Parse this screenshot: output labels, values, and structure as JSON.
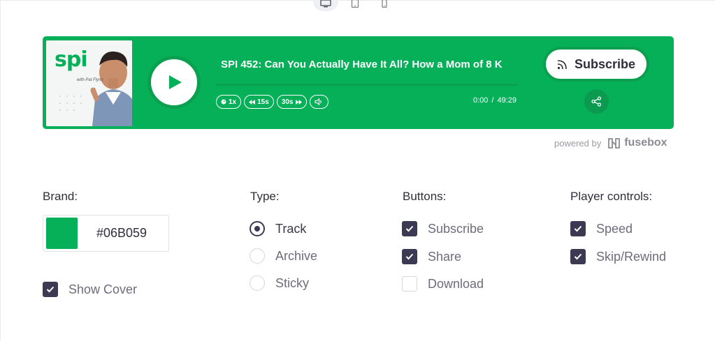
{
  "colors": {
    "brand": "#06B059",
    "dark": "#3b3a52"
  },
  "device_tabs": [
    {
      "icon": "desktop-icon",
      "active": true
    },
    {
      "icon": "tablet-icon",
      "active": false
    },
    {
      "icon": "mobile-icon",
      "active": false
    }
  ],
  "player": {
    "cover": {
      "logo": "spi",
      "byline": "with Pat Flynn"
    },
    "title": "SPI 452: Can You Actually Have It All? How a Mom of 8 K",
    "controls": {
      "speed": "1x",
      "rewind": "15s",
      "forward": "30s"
    },
    "current_time": "0:00",
    "separator": "/",
    "duration": "49:29",
    "subscribe_label": "Subscribe",
    "share_icon": "share-icon"
  },
  "powered": {
    "text": "powered by",
    "brand": "fusebox"
  },
  "settings": {
    "brand": {
      "label": "Brand:",
      "hex": "#06B059"
    },
    "show_cover": {
      "label": "Show Cover",
      "checked": true
    },
    "type": {
      "label": "Type:",
      "options": [
        {
          "label": "Track",
          "selected": true
        },
        {
          "label": "Archive",
          "selected": false
        },
        {
          "label": "Sticky",
          "selected": false
        }
      ]
    },
    "buttons": {
      "label": "Buttons:",
      "options": [
        {
          "label": "Subscribe",
          "checked": true
        },
        {
          "label": "Share",
          "checked": true
        },
        {
          "label": "Download",
          "checked": false
        }
      ]
    },
    "player_controls": {
      "label": "Player controls:",
      "options": [
        {
          "label": "Speed",
          "checked": true
        },
        {
          "label": "Skip/Rewind",
          "checked": true
        }
      ]
    }
  }
}
